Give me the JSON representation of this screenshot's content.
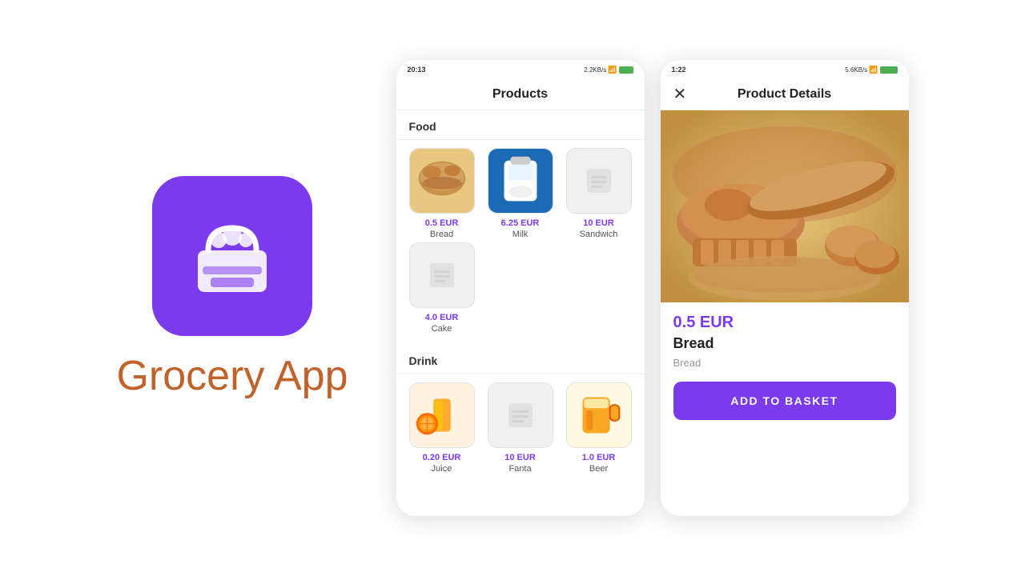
{
  "app": {
    "title": "Grocery App",
    "icon_alt": "Grocery basket icon"
  },
  "phone_products": {
    "status_bar": {
      "time": "20:13",
      "right": "2.2KB/s"
    },
    "header": {
      "title": "Products"
    },
    "sections": [
      {
        "name": "Food",
        "products": [
          {
            "price": "0.5 EUR",
            "name": "Bread",
            "has_image": true,
            "img_type": "bread"
          },
          {
            "price": "6.25 EUR",
            "name": "Milk",
            "has_image": true,
            "img_type": "milk"
          },
          {
            "price": "10 EUR",
            "name": "Sandwich",
            "has_image": false,
            "img_type": "placeholder"
          },
          {
            "price": "4.0 EUR",
            "name": "Cake",
            "has_image": false,
            "img_type": "placeholder"
          }
        ]
      },
      {
        "name": "Drink",
        "products": [
          {
            "price": "0.20 EUR",
            "name": "Juice",
            "has_image": true,
            "img_type": "juice"
          },
          {
            "price": "10 EUR",
            "name": "Fanta",
            "has_image": false,
            "img_type": "placeholder"
          },
          {
            "price": "1.0 EUR",
            "name": "Beer",
            "has_image": true,
            "img_type": "beer"
          }
        ]
      }
    ]
  },
  "phone_details": {
    "status_bar": {
      "time": "1:22",
      "right": "5.6KB/s"
    },
    "header": {
      "title": "Product Details"
    },
    "product": {
      "price": "0.5 EUR",
      "name": "Bread",
      "description": "Bread",
      "add_to_basket_label": "ADD TO BASKET"
    }
  }
}
